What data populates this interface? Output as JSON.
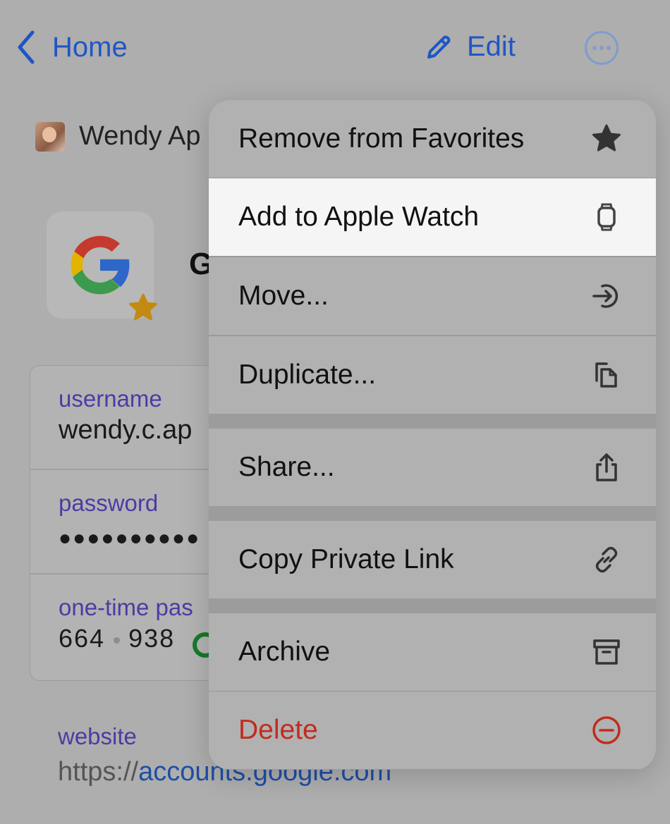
{
  "header": {
    "back_label": "Home",
    "edit_label": "Edit",
    "accent": "#1f56c4"
  },
  "vault": {
    "name": "Wendy Ap"
  },
  "item": {
    "title": "G"
  },
  "fields": [
    {
      "label": "username",
      "value": "wendy.c.ap"
    },
    {
      "label": "password",
      "value": "●●●●●●●●●●"
    },
    {
      "label": "one-time pas",
      "value_a": "664",
      "value_b": "938"
    }
  ],
  "website": {
    "label": "website",
    "prefix": "https://",
    "domain": "accounts.google.com"
  },
  "menu": {
    "items": [
      {
        "label": "Remove from Favorites",
        "icon": "star-icon"
      },
      {
        "label": "Add to Apple Watch",
        "icon": "apple-watch-icon"
      },
      {
        "label": "Move...",
        "icon": "move-icon"
      },
      {
        "label": "Duplicate...",
        "icon": "duplicate-icon"
      },
      {
        "label": "Share...",
        "icon": "share-icon"
      },
      {
        "label": "Copy Private Link",
        "icon": "link-icon"
      },
      {
        "label": "Archive",
        "icon": "archive-icon"
      },
      {
        "label": "Delete",
        "icon": "delete-icon",
        "color": "#c22b1e"
      }
    ]
  }
}
